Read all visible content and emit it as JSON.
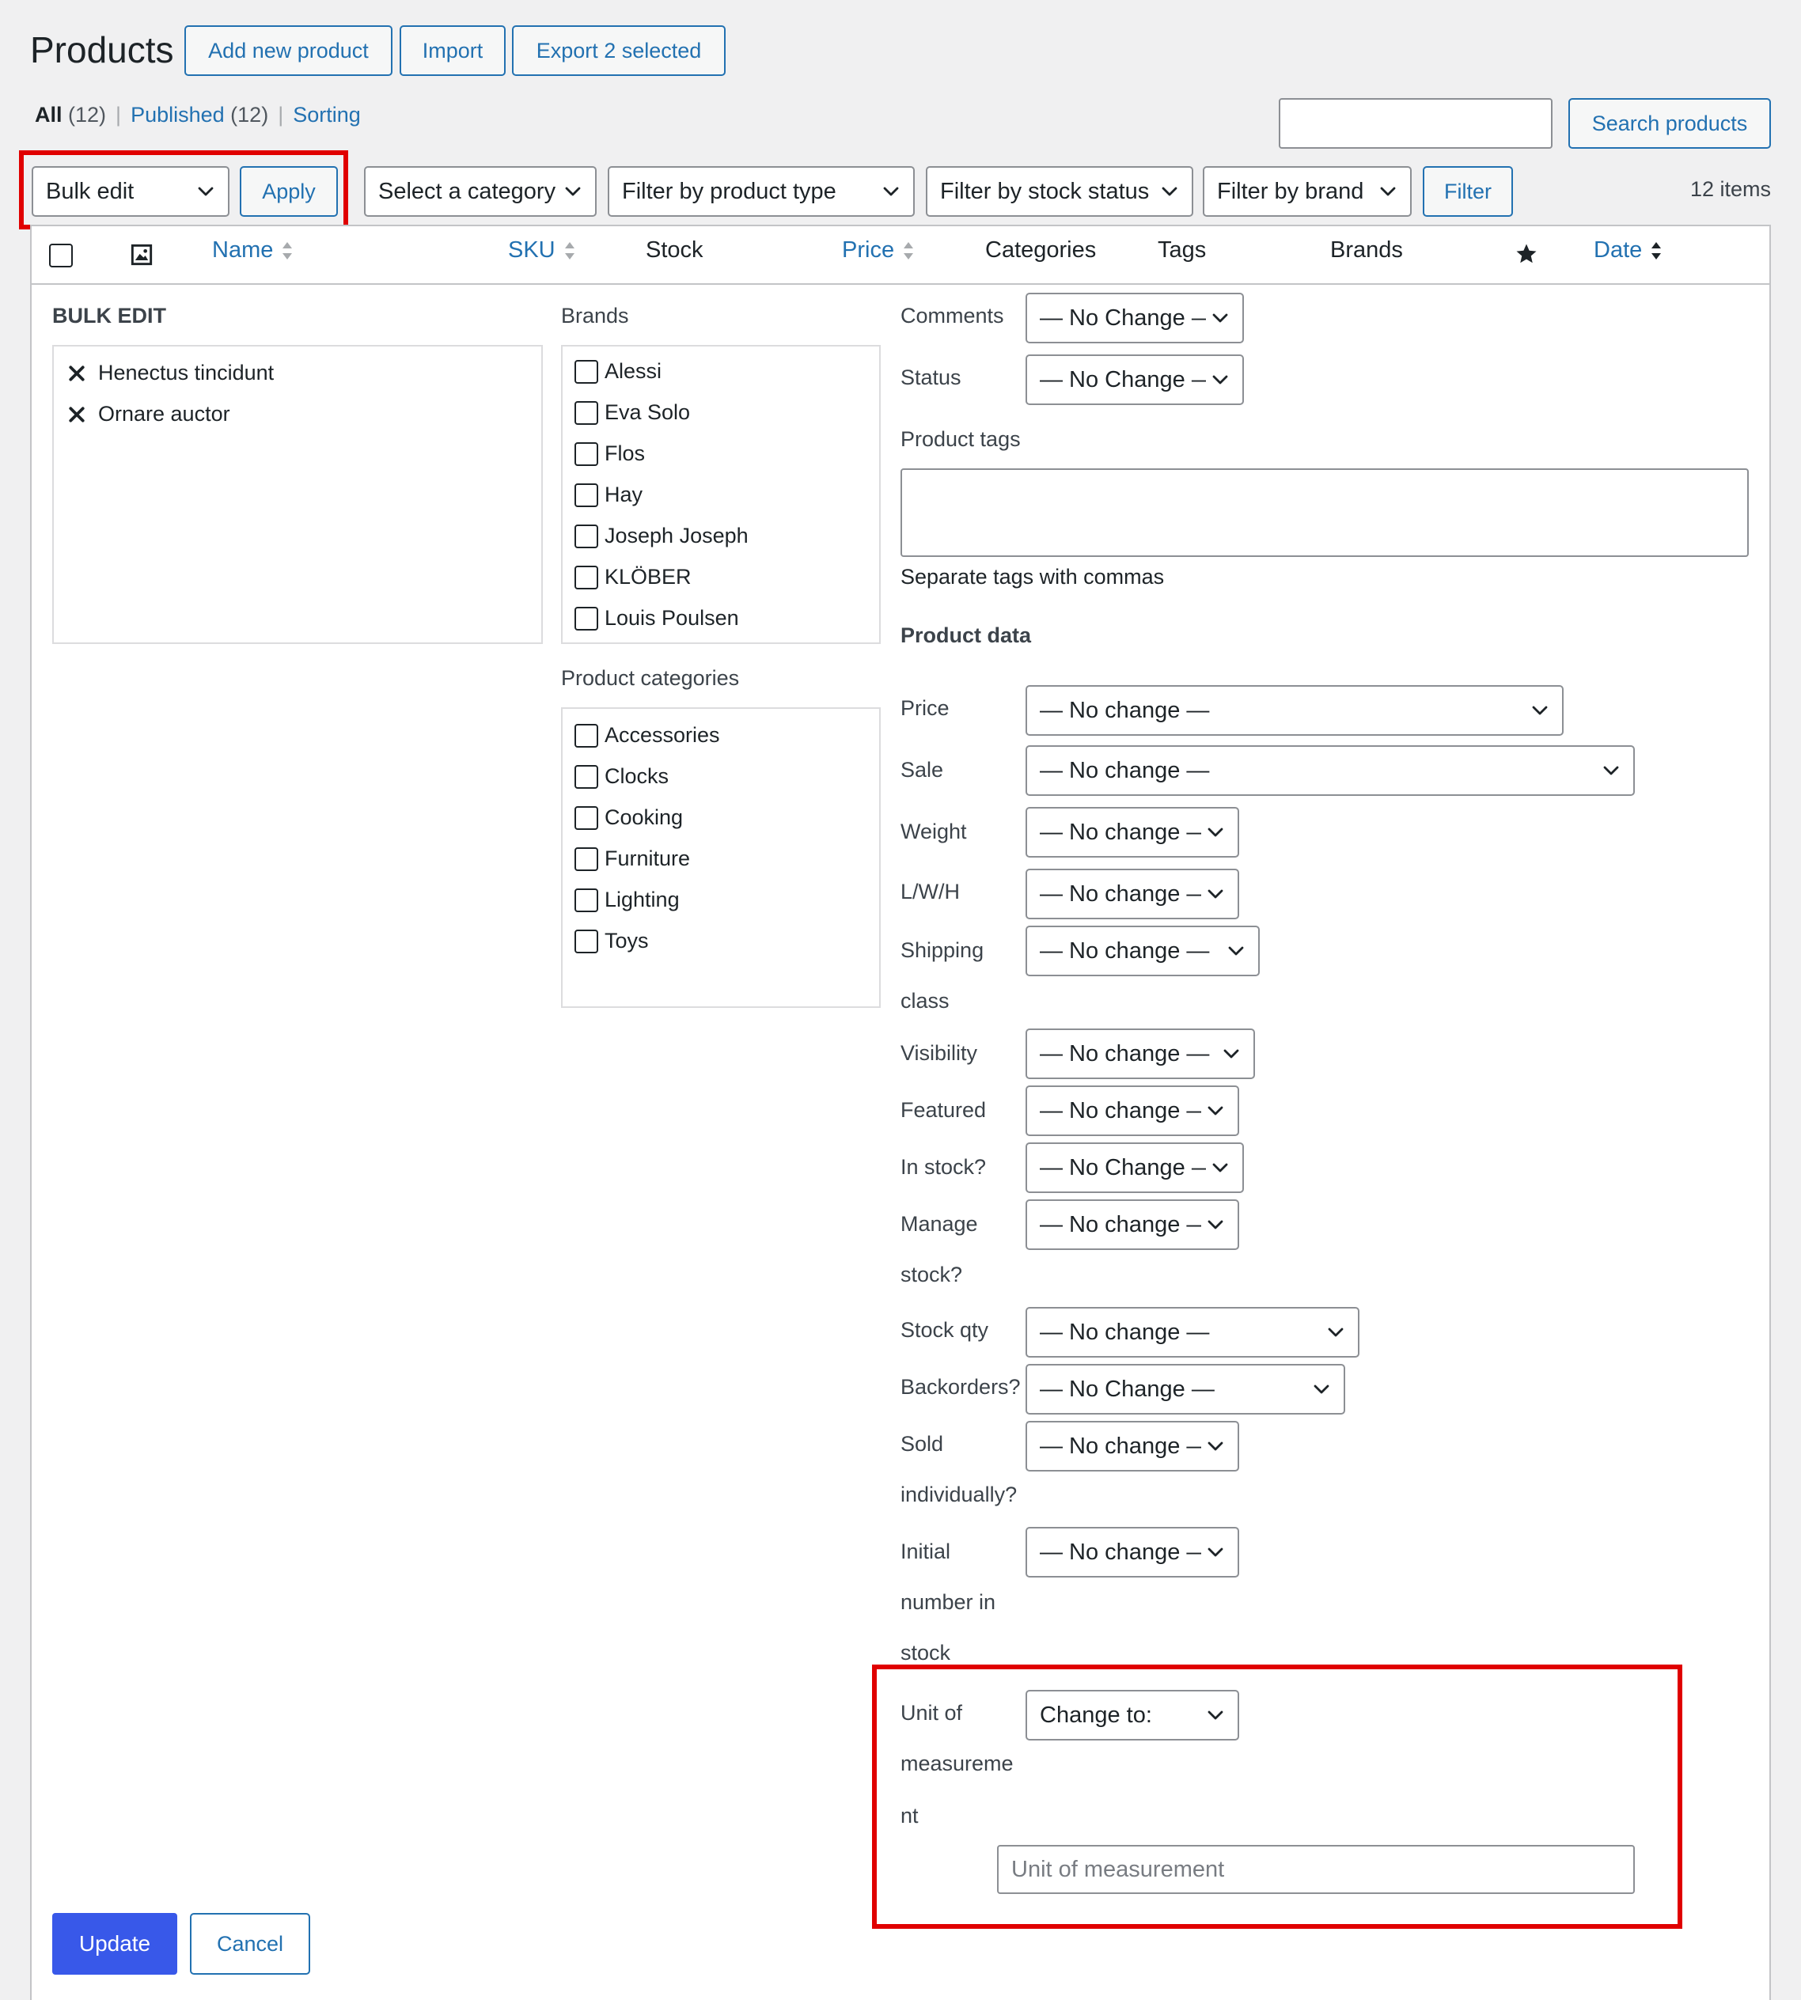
{
  "header": {
    "title": "Products",
    "add_new": "Add new product",
    "import": "Import",
    "export": "Export 2 selected"
  },
  "subsubsub": {
    "all_label": "All",
    "all_count": "(12)",
    "published_label": "Published",
    "published_count": "(12)",
    "sorting_label": "Sorting",
    "sep": "|"
  },
  "search": {
    "value": "",
    "button": "Search products"
  },
  "tablenav": {
    "bulk_action": "Bulk edit",
    "apply": "Apply",
    "category": "Select a category",
    "product_type": "Filter by product type",
    "stock_status": "Filter by stock status",
    "brand": "Filter by brand",
    "filter": "Filter",
    "items_count": "12 items"
  },
  "columns": {
    "name": "Name",
    "sku": "SKU",
    "stock": "Stock",
    "price": "Price",
    "categories": "Categories",
    "tags": "Tags",
    "brands": "Brands",
    "date": "Date"
  },
  "bulk": {
    "title": "BULK EDIT",
    "items": [
      "Henectus tincidunt",
      "Ornare auctor"
    ],
    "brands_label": "Brands",
    "brands": [
      "Alessi",
      "Eva Solo",
      "Flos",
      "Hay",
      "Joseph Joseph",
      "KLÖBER",
      "Louis Poulsen"
    ],
    "categories_label": "Product categories",
    "categories": [
      "Accessories",
      "Clocks",
      "Cooking",
      "Furniture",
      "Lighting",
      "Toys"
    ],
    "comments_label": "Comments",
    "comments_value": "— No Change —",
    "status_label": "Status",
    "status_value": "— No Change —",
    "tags_label": "Product tags",
    "tags_value": "",
    "tags_help": "Separate tags with commas",
    "product_data_label": "Product data",
    "price_label": "Price",
    "price_value": "— No change —",
    "sale_label": "Sale",
    "sale_value": "— No change —",
    "weight_label": "Weight",
    "weight_value": "— No change —",
    "lwh_label": "L/W/H",
    "lwh_value": "— No change —",
    "shipping_label_1": "Shipping",
    "shipping_label_2": "class",
    "shipping_value": "— No change —",
    "visibility_label": "Visibility",
    "visibility_value": "— No change —",
    "featured_label": "Featured",
    "featured_value": "— No change —",
    "instock_label": "In stock?",
    "instock_value": "— No Change —",
    "manage_label_1": "Manage",
    "manage_label_2": "stock?",
    "manage_value": "— No change —",
    "stockqty_label": "Stock qty",
    "stockqty_value": "— No change —",
    "backorders_label": "Backorders?",
    "backorders_value": "— No Change —",
    "sold_label_1": "Sold",
    "sold_label_2": "individually?",
    "sold_value": "— No change —",
    "initial_label_1": "Initial",
    "initial_label_2": "number in",
    "initial_label_3": "stock",
    "initial_value": "— No change —",
    "uom_label_1": "Unit of",
    "uom_label_2": "measureme",
    "uom_label_3": "nt",
    "uom_select": "Change to:",
    "uom_placeholder": "Unit of measurement",
    "update": "Update",
    "cancel": "Cancel"
  },
  "colors": {
    "link": "#2271b1",
    "primary_button": "#3858e9",
    "highlight": "#e00000",
    "background": "#f0f0f1"
  }
}
